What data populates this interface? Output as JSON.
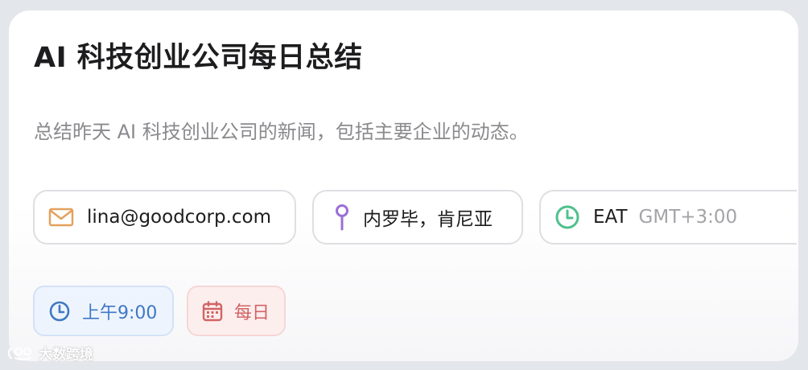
{
  "card": {
    "title": "AI 科技创业公司每日总结",
    "description": "总结昨天 AI 科技创业公司的新闻，包括主要企业的动态。"
  },
  "contact": {
    "email": "lina@goodcorp.com",
    "email_icon": "mail-icon",
    "location": "内罗毕，肯尼亚",
    "location_icon": "map-pin-icon",
    "timezone": "EAT",
    "timezone_offset": "GMT+3:00",
    "timezone_icon": "clock-icon"
  },
  "schedule": {
    "time": "上午9:00",
    "time_icon": "clock-icon",
    "frequency": "每日",
    "frequency_icon": "calendar-icon"
  },
  "watermark": {
    "text": "大数跨境"
  },
  "colors": {
    "mail_icon": "#e3a15e",
    "pin_icon": "#9b6fd6",
    "tz_clock_icon": "#4fc08d",
    "time_pill_text": "#3f78c4",
    "freq_pill_text": "#d16464"
  }
}
